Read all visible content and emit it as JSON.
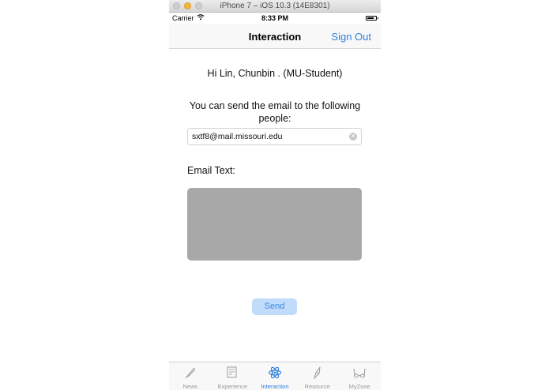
{
  "window": {
    "title": "iPhone 7 – iOS 10.3 (14E8301)"
  },
  "status_bar": {
    "carrier": "Carrier",
    "time": "8:33 PM"
  },
  "nav": {
    "title": "Interaction",
    "sign_out_label": "Sign Out"
  },
  "content": {
    "greeting": "Hi Lin, Chunbin  . (MU-Student)",
    "send_info": "You can send the email to the following people:",
    "email_value": "sxtf8@mail.missouri.edu",
    "email_text_label": "Email Text:",
    "send_label": "Send"
  },
  "tabs": [
    {
      "label": "News",
      "icon": "quill-icon"
    },
    {
      "label": "Experience",
      "icon": "certificate-icon"
    },
    {
      "label": "Interaction",
      "icon": "atom-icon",
      "active": true
    },
    {
      "label": "Resource",
      "icon": "pen-nib-icon"
    },
    {
      "label": "MyZone",
      "icon": "glasses-icon"
    }
  ],
  "colors": {
    "accent": "#2f7fe0",
    "text_area": "#a8a8a8",
    "send_button_bg": "#c1dcfa"
  }
}
